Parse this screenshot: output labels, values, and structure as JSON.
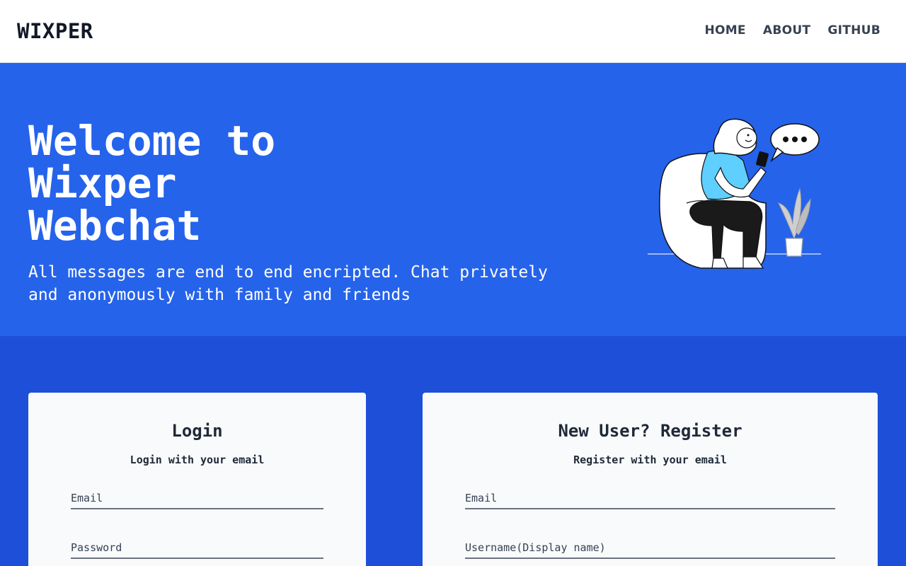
{
  "navbar": {
    "brand": "WIXPER",
    "links": [
      {
        "label": "HOME"
      },
      {
        "label": "ABOUT"
      },
      {
        "label": "GITHUB"
      }
    ]
  },
  "hero": {
    "title": "Welcome to Wixper Webchat",
    "subtitle": "All messages are end to end encripted. Chat privately and anonymously with family and friends",
    "illustration_icon": "woman-chatting-on-phone-illustration"
  },
  "login": {
    "title": "Login",
    "subtitle": "Login with your email",
    "email_placeholder": "Email",
    "password_placeholder": "Password"
  },
  "register": {
    "title": "New User? Register",
    "subtitle": "Register with your email",
    "email_placeholder": "Email",
    "username_placeholder": "Username(Display name)"
  },
  "colors": {
    "hero_bg": "#2563eb",
    "page_bg": "#1e4fd8",
    "card_bg": "#f8fafc",
    "accent_cyan": "#5ecfff"
  }
}
